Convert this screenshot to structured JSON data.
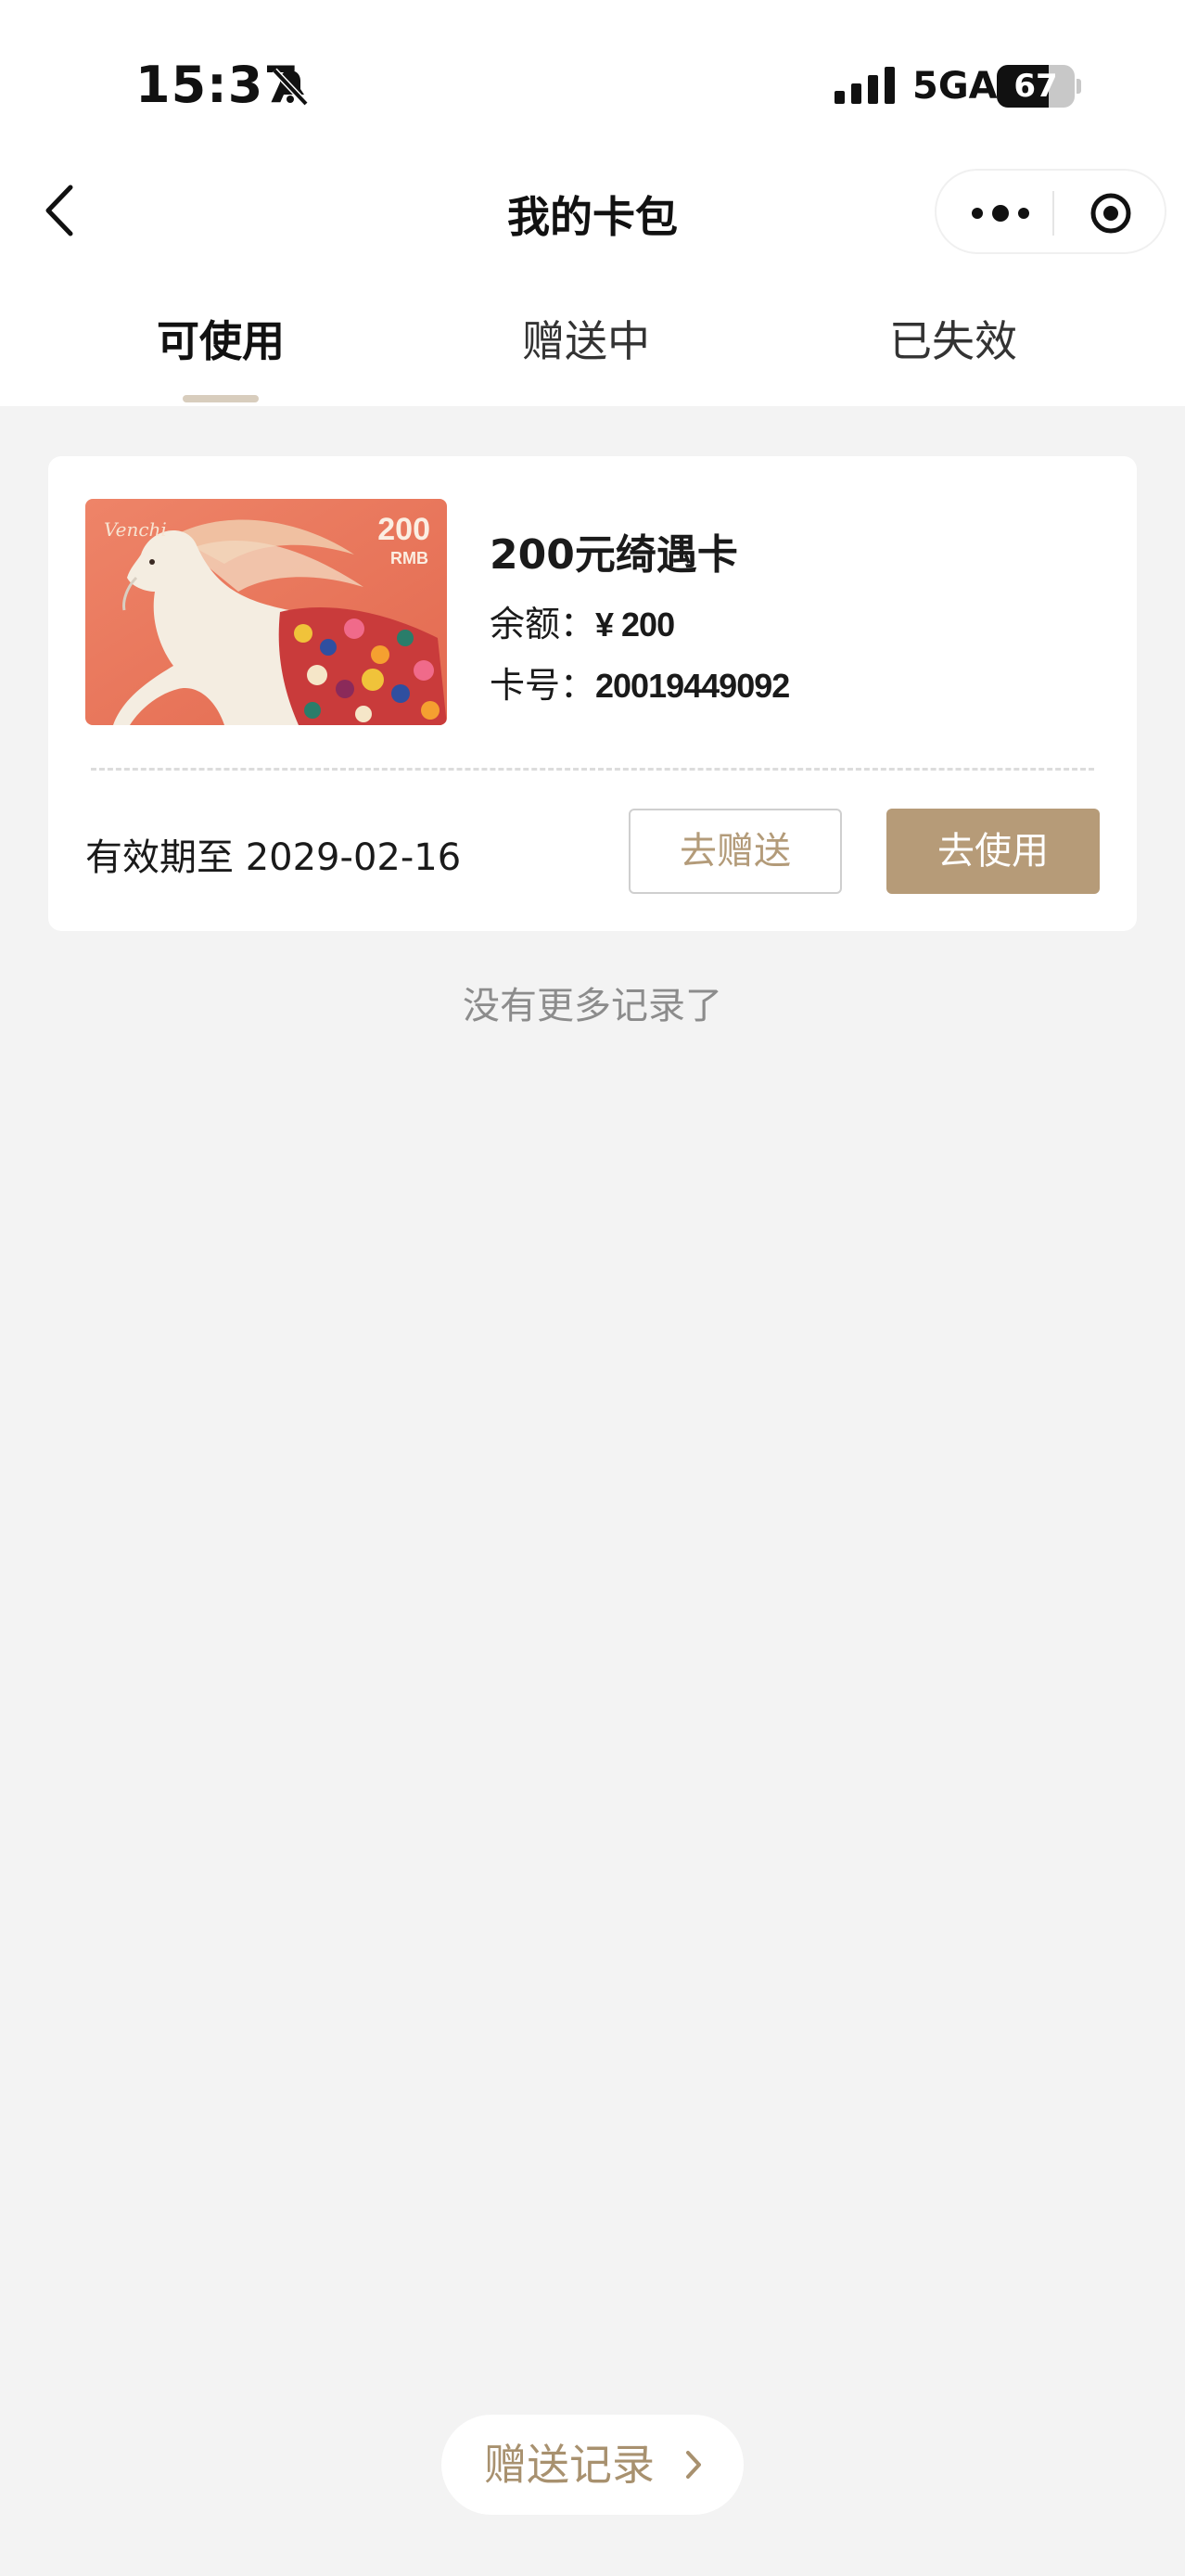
{
  "status_bar": {
    "time": "15:37",
    "network": "5GA",
    "battery": "67",
    "battery_level_percent": 67
  },
  "nav": {
    "title": "我的卡包"
  },
  "tabs": [
    {
      "label": "可使用",
      "active": true
    },
    {
      "label": "赠送中",
      "active": false
    },
    {
      "label": "已失效",
      "active": false
    }
  ],
  "card": {
    "image": {
      "brand": "Venchi",
      "amount": "200",
      "currency": "RMB"
    },
    "name": "200元绮遇卡",
    "balance_label": "余额：",
    "balance_value": "¥ 200",
    "number_label": "卡号：",
    "number_value": "20019449092",
    "expiry": "有效期至 2029-02-16",
    "gift_button": "去赠送",
    "use_button": "去使用"
  },
  "list_end_text": "没有更多记录了",
  "records_button": "赠送记录",
  "colors": {
    "accent": "#b69b78",
    "accent_text": "#a8916f",
    "page_background": "#f3f3f3",
    "tab_indicator": "#d8cdbd"
  }
}
